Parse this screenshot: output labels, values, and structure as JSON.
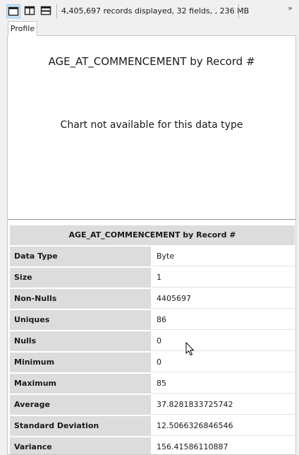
{
  "toolbar": {
    "status_text": "4,405,697 records displayed, 32 fields, , 236 MB",
    "more_glyph": "»"
  },
  "tabs": [
    {
      "label": "Profile",
      "active": true
    }
  ],
  "chart": {
    "title": "AGE_AT_COMMENCEMENT by Record #",
    "message": "Chart not available for this data type"
  },
  "stats": {
    "header": "AGE_AT_COMMENCEMENT by Record #",
    "rows": [
      {
        "label": "Data Type",
        "value": "Byte"
      },
      {
        "label": "Size",
        "value": "1"
      },
      {
        "label": "Non-Nulls",
        "value": "4405697"
      },
      {
        "label": "Uniques",
        "value": "86"
      },
      {
        "label": "Nulls",
        "value": "0"
      },
      {
        "label": "Minimum",
        "value": "0"
      },
      {
        "label": "Maximum",
        "value": "85"
      },
      {
        "label": "Average",
        "value": "37.8281833725742"
      },
      {
        "label": "Standard Deviation",
        "value": "12.5066326846546"
      },
      {
        "label": "Variance",
        "value": "156.41586110887"
      }
    ]
  },
  "colors": {
    "accent": "#1e70c8",
    "active_button_bg": "#cce4f7",
    "label_bg": "#dcdcdc"
  },
  "icons": {
    "layout_single": "single-panel-layout-icon",
    "layout_vertical": "vertical-split-layout-icon",
    "layout_horizontal": "horizontal-split-layout-icon",
    "overflow": "chevron-double-right-icon",
    "cursor": "mouse-pointer-icon"
  }
}
